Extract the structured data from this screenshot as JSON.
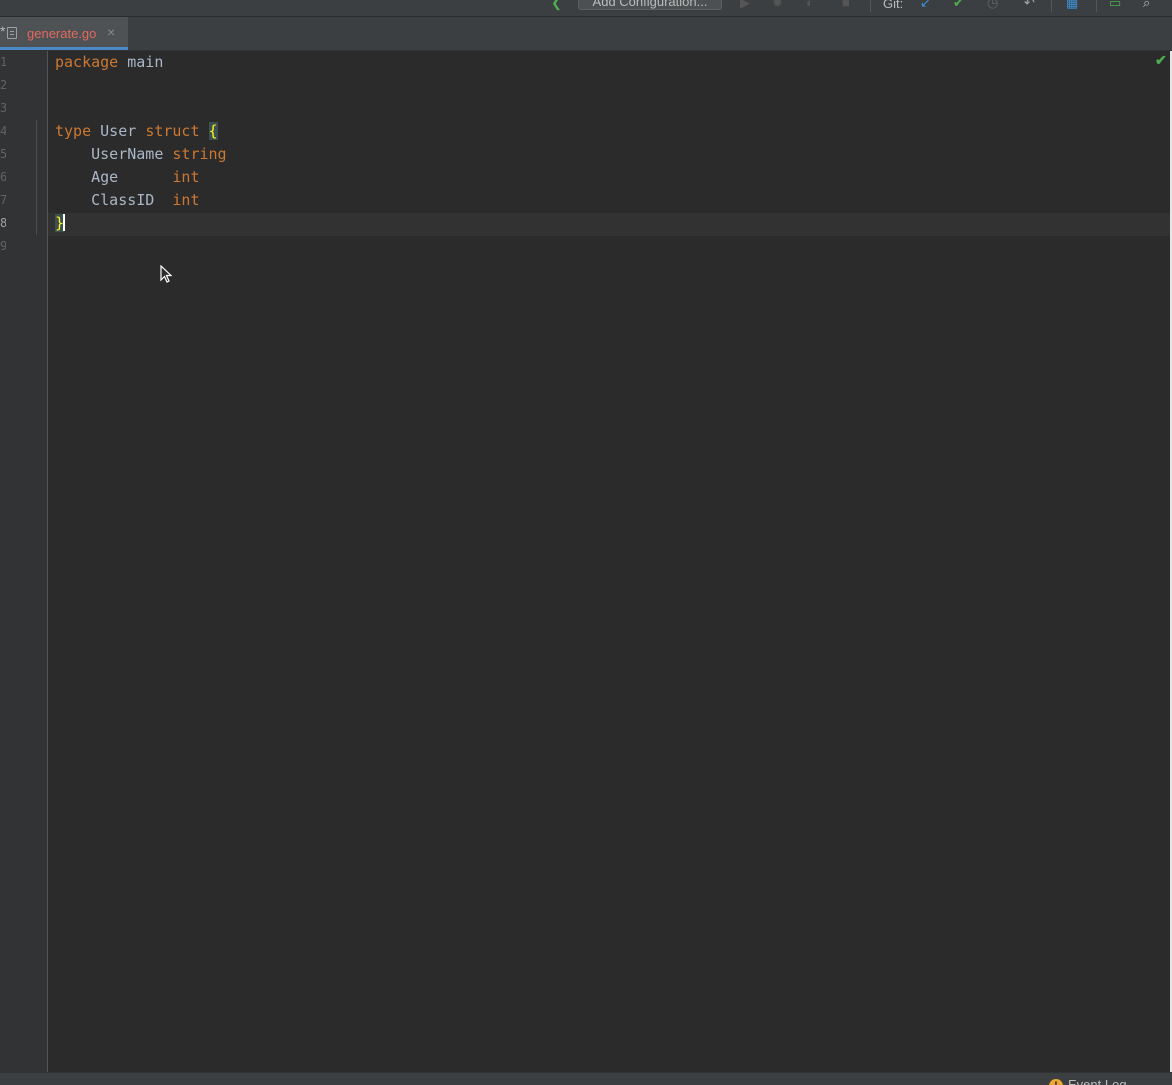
{
  "toolbar": {
    "add_configuration": "Add Configuration...",
    "git_label": "Git:",
    "icons": [
      "back-arrow-icon",
      "run-icon",
      "debug-icon",
      "profile-icon",
      "stop-icon",
      "git-update-icon",
      "git-commit-icon",
      "history-icon",
      "revert-icon",
      "project-structure-icon",
      "vcs-log-icon",
      "search-icon"
    ]
  },
  "tab": {
    "modified_marker": "*",
    "label": "generate.go",
    "close": "×"
  },
  "gutter": {
    "line_numbers": [
      "1",
      "2",
      "3",
      "4",
      "5",
      "6",
      "7",
      "8",
      "9"
    ]
  },
  "code": {
    "line1": {
      "kw": "package",
      "rest": " main"
    },
    "line4": {
      "kw1": "type",
      "name": " User ",
      "kw2": "struct",
      "brace": "{"
    },
    "line5": {
      "field": "    UserName ",
      "type": "string"
    },
    "line6": {
      "field": "    Age      ",
      "type": "int"
    },
    "line7": {
      "field": "    ClassID  ",
      "type": "int"
    },
    "line8": {
      "brace": "}"
    }
  },
  "status": {
    "event_log": "Event Log",
    "event_badge": "!"
  },
  "colors": {
    "keyword": "#cc7832",
    "identifier": "#a9b7c6",
    "brace_match": "#ffef28",
    "tab_modified": "#e26a5e",
    "tab_accent": "#4a88c7"
  }
}
